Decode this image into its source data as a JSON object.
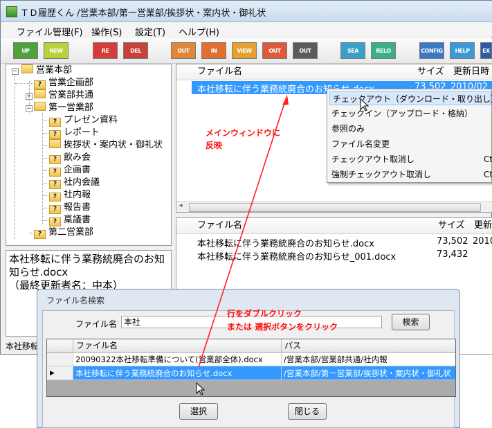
{
  "window": {
    "title": "ＴＤ履歴くん /営業本部/第一営業部/挨拶状・案内状・御礼状"
  },
  "menu": [
    "ファイル管理(F)",
    "操作(S)",
    "設定(T)",
    "ヘルプ(H)"
  ],
  "toolbar": [
    {
      "label": "UP",
      "color": "#4fa13a"
    },
    {
      "label": "NEW",
      "color": "#b6d43a"
    },
    {
      "label": "RE NAME",
      "color": "#d83b3b"
    },
    {
      "label": "DEL",
      "color": "#c8423a"
    },
    {
      "label": "OUT",
      "color": "#e0873a"
    },
    {
      "label": "IN",
      "color": "#e06f30"
    },
    {
      "label": "VIEW",
      "color": "#e8a030"
    },
    {
      "label": "OUT",
      "color": "#e05a3a"
    },
    {
      "label": "OUT",
      "color": "#5a5a5a"
    },
    {
      "label": "SEA RCH",
      "color": "#3aa0c8"
    },
    {
      "label": "RELO AD",
      "color": "#3ab08a"
    },
    {
      "label": "CONFIG",
      "color": "#3a78c8"
    },
    {
      "label": "HELP",
      "color": "#3a9ad8"
    },
    {
      "label": "EX",
      "color": "#2a5aa8"
    }
  ],
  "tree": {
    "root": "営業本部",
    "n1": "営業企画部",
    "n2": "営業部共通",
    "n3": "第一営業部",
    "c1": "プレゼン資料",
    "c2": "レポート",
    "c3": "挨拶状・案内状・御礼状",
    "c4": "飲み会",
    "c5": "企画書",
    "c6": "社内会議",
    "c7": "社内報",
    "c8": "報告書",
    "c9": "稟議書",
    "n4": "第二営業部"
  },
  "info": {
    "line1": "本社移転に伴う業務統廃合のお知",
    "line2": "知らせ.docx",
    "line3": "（最終更新者名：中本）"
  },
  "status_text": "本社移転",
  "upper_list": {
    "headers": {
      "name": "ファイル名",
      "size": "サイズ",
      "date": "更新日時"
    },
    "row": {
      "name": "本社移転に伴う業務統廃合のお知らせ.docx",
      "size": "73,502",
      "date": "2010/02"
    }
  },
  "context_menu": [
    {
      "label": "チェックアウト（ダウンロード・取り出し）",
      "shortcut": ""
    },
    {
      "label": "チェックイン（アップロード・格納）",
      "shortcut": ""
    },
    {
      "label": "参照のみ",
      "shortcut": ""
    },
    {
      "label": "ファイル名変更",
      "shortcut": ""
    },
    {
      "label": "チェックアウト取消し",
      "shortcut": "Ct"
    },
    {
      "label": "強制チェックアウト取消し",
      "shortcut": "Ct"
    }
  ],
  "lower_list": {
    "headers": {
      "name": "ファイル名",
      "size": "サイズ",
      "date": "更新"
    },
    "rows": [
      {
        "name": "本社移転に伴う業務統廃合のお知らせ.docx",
        "size": "73,502",
        "date": "2010"
      },
      {
        "name": "本社移転に伴う業務統廃合のお知らせ_001.docx",
        "size": "73,432",
        "date": ""
      }
    ]
  },
  "annotations": {
    "reflect1": "メインウィンドウに",
    "reflect2": "反映",
    "dbl1": "行をダブルクリック",
    "dbl2": "または 選択ボタンをクリック"
  },
  "dialog": {
    "title": "ファイル名検索",
    "field_label": "ファイル名",
    "field_value": "本社",
    "search_button": "検索",
    "headers": {
      "name": "ファイル名",
      "path": "パス"
    },
    "rows": [
      {
        "name": "20090322本社移転準備について(営業部全体).docx",
        "path": "/営業本部/営業部共通/社内報"
      },
      {
        "name": "本社移転に伴う業務統廃合のお知らせ.docx",
        "path": "/営業本部/第一営業部/挨拶状・案内状・御礼状"
      }
    ],
    "select_button": "選択",
    "close_button": "閉じる"
  }
}
